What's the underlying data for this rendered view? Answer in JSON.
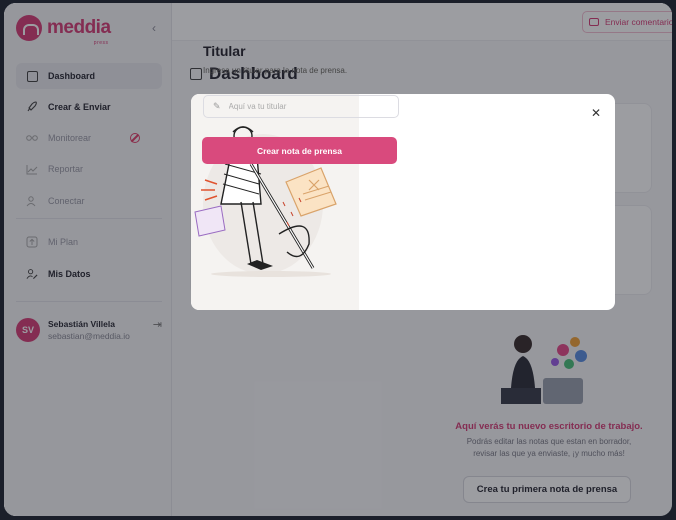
{
  "brand": {
    "name": "meddia",
    "tagline": "press"
  },
  "topbar": {
    "feedback_label": "Enviar comentario"
  },
  "sidebar": {
    "items": [
      {
        "label": "Dashboard",
        "icon": "dashboard-icon",
        "active": true
      },
      {
        "label": "Crear & Enviar",
        "icon": "rocket-icon"
      },
      {
        "label": "Monitorear",
        "icon": "glasses-icon",
        "disabled": true
      },
      {
        "label": "Reportar",
        "icon": "chart-line-icon",
        "disabled": true
      },
      {
        "label": "Conectar",
        "icon": "users-icon",
        "disabled": true
      },
      {
        "label": "Mi Plan",
        "icon": "upgrade-icon",
        "disabled": true
      },
      {
        "label": "Mis Datos",
        "icon": "user-edit-icon"
      }
    ],
    "user": {
      "initials": "SV",
      "name": "Sebastián Villela",
      "email": "sebastian@meddia.io"
    }
  },
  "main": {
    "title": "Dashboard",
    "empty_state": {
      "title": "Aquí verás tu nuevo escritorio de trabajo.",
      "description_line1": "Podrás editar las notas que estan en borrador,",
      "description_line2": "revisar las que ya enviaste, ¡y mucho más!",
      "button_label": "Crea tu primera nota de prensa"
    }
  },
  "modal": {
    "title": "Titular",
    "subtitle": "Ingresa un titular para la nota de prensa.",
    "input_placeholder": "Aquí va tu titular",
    "input_value": "",
    "submit_label": "Crear nota de prensa"
  },
  "colors": {
    "brand": "#d63f78",
    "accent_button": "#d94a7d",
    "blocked": "#e0406c"
  }
}
